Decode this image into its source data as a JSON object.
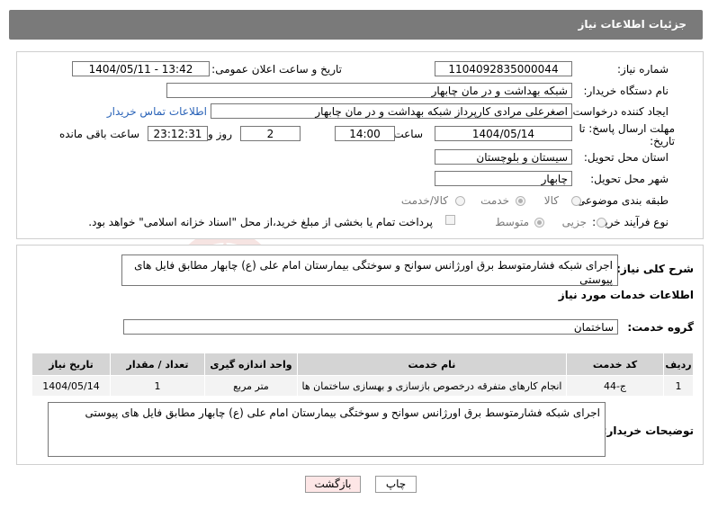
{
  "header": {
    "title": "جزئیات اطلاعات نیاز"
  },
  "watermark": {
    "text": "AriaTender.neT"
  },
  "form": {
    "need_number_label": "شماره نیاز:",
    "need_number": "1104092835000044",
    "announce_label": "تاریخ و ساعت اعلان عمومی:",
    "announce_value": "1404/05/11 - 13:42",
    "buyer_org_label": "نام دستگاه خریدار:",
    "buyer_org": "شبکه بهداشت و در مان چابهار",
    "creator_label": "ایجاد کننده درخواست:",
    "creator": "اصغرعلی مرادی کارپرداز شبکه بهداشت و در مان چابهار",
    "contact_link": "اطلاعات تماس خریدار",
    "deadline_label": "مهلت ارسال پاسخ: تا تاریخ:",
    "deadline_date": "1404/05/14",
    "time_label": "ساعت",
    "deadline_time": "14:00",
    "days": "2",
    "days_label": "روز و",
    "remaining": "23:12:31",
    "remaining_label": "ساعت باقی مانده",
    "province_label": "استان محل تحویل:",
    "province": "سیستان و بلوچستان",
    "city_label": "شهر محل تحویل:",
    "city": "چابهار",
    "category_label": "طبقه بندی موضوعی:",
    "category_options": [
      "کالا",
      "خدمت",
      "کالا/خدمت"
    ],
    "process_label": "نوع فرآیند خرید :",
    "process_options": [
      "جزیی",
      "متوسط"
    ],
    "payment_note": "پرداخت تمام یا بخشی از مبلغ خرید،از محل \"اسناد خزانه اسلامی\" خواهد بود."
  },
  "summary": {
    "label": "شرح کلی نیاز:",
    "text": "اجرای شبکه فشارمتوسط برق اورژانس سوانح و سوختگی بیمارستان امام علی (ع) چابهار مطابق فایل های پیوستی"
  },
  "services": {
    "section_title": "اطلاعات خدمات مورد نیاز",
    "group_label": "گروه خدمت:",
    "group_value": "ساختمان",
    "columns": [
      "ردیف",
      "کد خدمت",
      "نام خدمت",
      "واحد اندازه گیری",
      "تعداد / مقدار",
      "تاریخ نیاز"
    ],
    "rows": [
      [
        "1",
        "ج-44",
        "انجام کارهای متفرقه درخصوص بازسازی و بهسازی ساختمان ها",
        "متر مربع",
        "1",
        "1404/05/14"
      ]
    ]
  },
  "buyer_notes": {
    "label": "توضیحات خریدار:",
    "text": "اجرای شبکه فشارمتوسط برق اورژانس سوانح و سوختگی بیمارستان امام علی (ع) چابهار مطابق فایل های پیوستی"
  },
  "buttons": {
    "print": "چاپ",
    "back": "بازگشت"
  }
}
